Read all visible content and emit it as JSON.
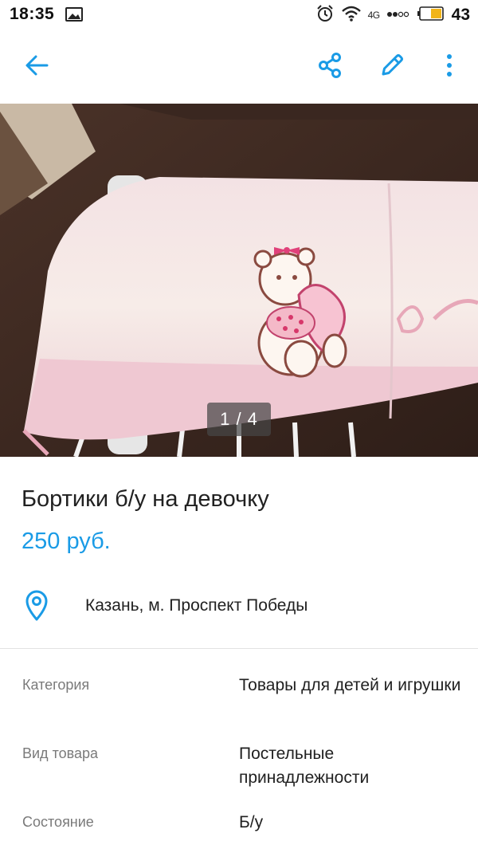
{
  "status_bar": {
    "time": "18:35",
    "network": "4G",
    "battery": "43",
    "icons": [
      "gallery-icon",
      "alarm-icon",
      "wifi-icon",
      "signal-dots-icon",
      "battery-icon"
    ]
  },
  "toolbar": {
    "icons": [
      "back-arrow-icon",
      "share-icon",
      "edit-pencil-icon",
      "more-vertical-icon"
    ],
    "accent_color": "#1a9be6"
  },
  "gallery": {
    "counter": "1 / 4"
  },
  "listing": {
    "title": "Бортики б/у на девочку",
    "price": "250 руб.",
    "price_color": "#1a9be6",
    "location": "Казань, м. Проспект Победы"
  },
  "params": [
    {
      "name": "Категория",
      "value": "Товары для детей и игрушки"
    },
    {
      "name": "Вид товара",
      "value": "Постельные принадлежности"
    },
    {
      "name": "Состояние",
      "value": "Б/у"
    }
  ]
}
